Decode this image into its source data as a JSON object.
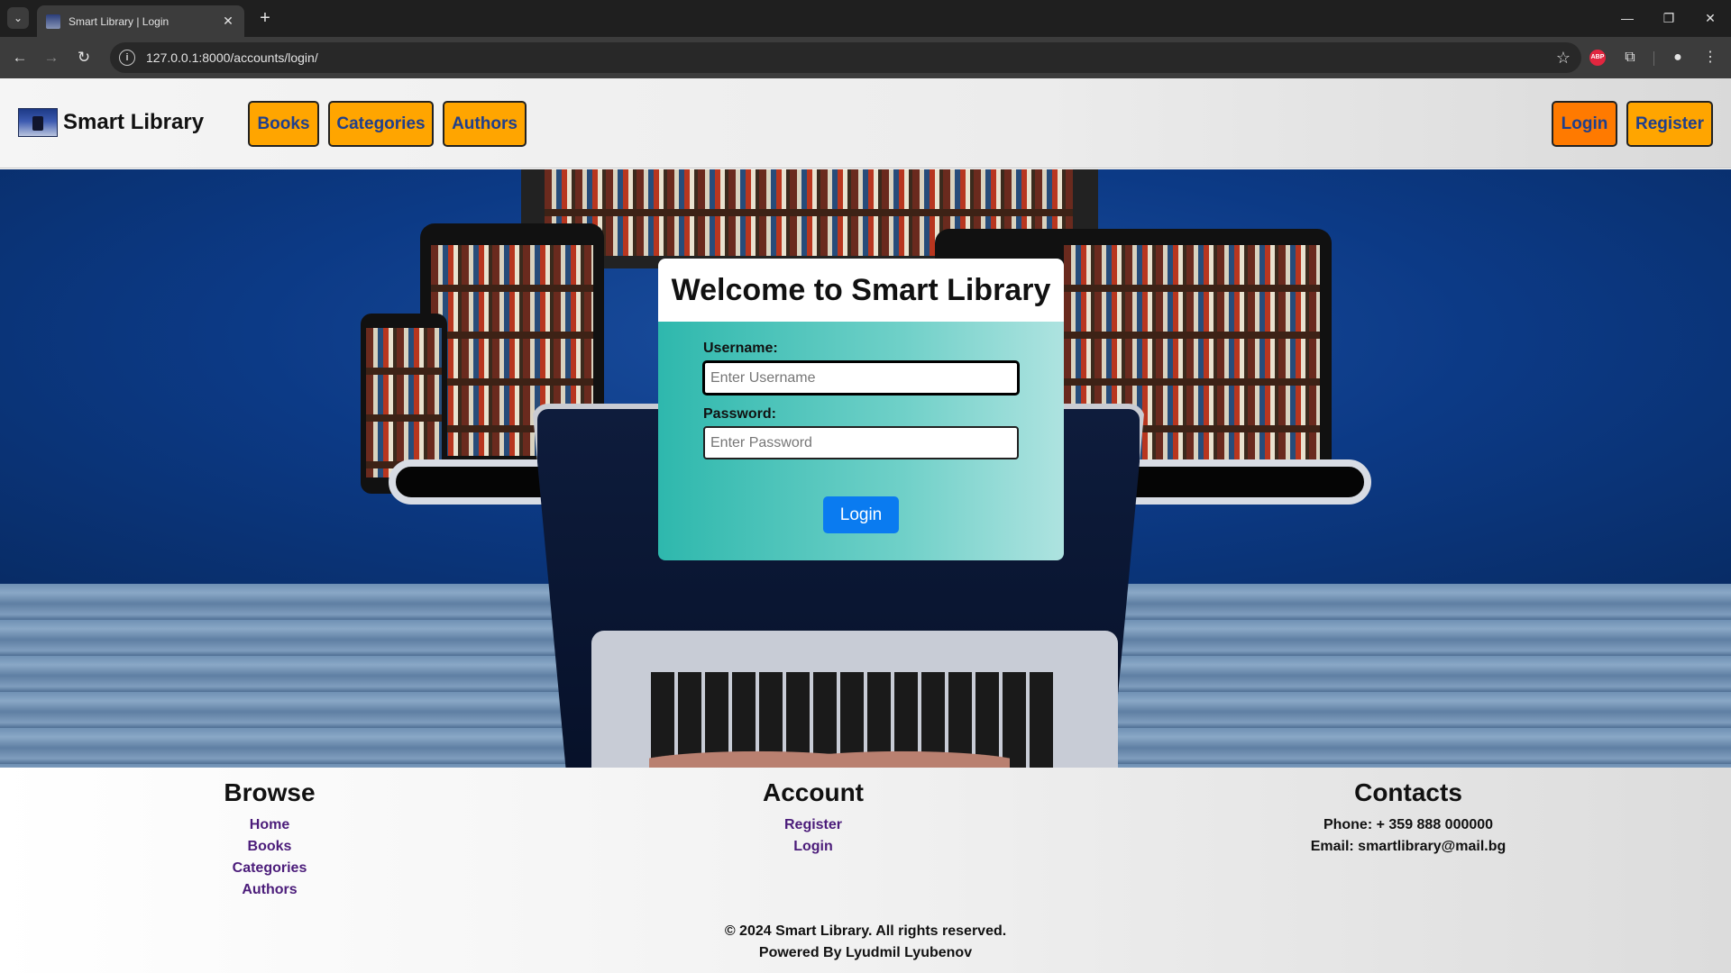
{
  "browser": {
    "tab_title": "Smart Library | Login",
    "url": "127.0.0.1:8000/accounts/login/",
    "abp_label": "ABP"
  },
  "header": {
    "brand": "Smart Library",
    "nav": [
      "Books",
      "Categories",
      "Authors"
    ],
    "login": "Login",
    "register": "Register"
  },
  "login_form": {
    "title": "Welcome to Smart Library",
    "username_label": "Username:",
    "username_placeholder": "Enter Username",
    "password_label": "Password:",
    "password_placeholder": "Enter Password",
    "submit": "Login"
  },
  "footer": {
    "browse": {
      "heading": "Browse",
      "links": [
        "Home",
        "Books",
        "Categories",
        "Authors"
      ]
    },
    "account": {
      "heading": "Account",
      "links": [
        "Register",
        "Login"
      ]
    },
    "contacts": {
      "heading": "Contacts",
      "phone": "Phone: + 359 888 000000",
      "email": "Email: smartlibrary@mail.bg"
    },
    "copyright": "© 2024 Smart Library. All rights reserved.",
    "powered_by": "Powered By Lyudmil Lyubenov"
  }
}
